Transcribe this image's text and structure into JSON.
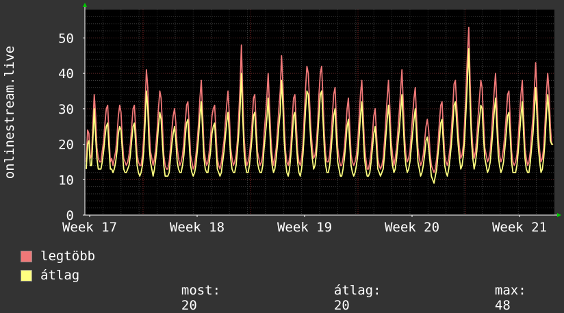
{
  "colors": {
    "background": "#333333",
    "plot_background": "#000000",
    "grid_minor": "#3a3a3a",
    "grid_major_vertical": "#7a1f1f",
    "max_series": "#f07878",
    "avg_series": "#ffff80",
    "axis_arrow": "#00cc00"
  },
  "chart_data": {
    "type": "line",
    "ylabel": "onlinestream.live",
    "ylim": [
      0,
      58
    ],
    "yticks": [
      0,
      10,
      20,
      30,
      40,
      50
    ],
    "xticks": [
      "Week 17",
      "Week 18",
      "Week 19",
      "Week 20",
      "Week 21"
    ],
    "grid": true,
    "series": [
      {
        "name": "legtöbb",
        "color": "#f07878",
        "values": [
          15,
          24,
          23,
          16,
          17,
          26,
          34,
          28,
          19,
          16,
          15,
          15,
          18,
          21,
          26,
          30,
          31,
          23,
          15,
          16,
          14,
          16,
          18,
          22,
          28,
          31,
          29,
          21,
          16,
          15,
          14,
          15,
          17,
          20,
          25,
          30,
          31,
          24,
          17,
          15,
          14,
          14,
          17,
          22,
          31,
          41,
          36,
          25,
          18,
          16,
          14,
          16,
          19,
          24,
          30,
          35,
          33,
          25,
          17,
          14,
          13,
          13,
          15,
          19,
          24,
          28,
          30,
          26,
          19,
          16,
          14,
          15,
          17,
          21,
          26,
          31,
          32,
          25,
          17,
          15,
          13,
          14,
          17,
          21,
          26,
          33,
          38,
          29,
          19,
          16,
          14,
          15,
          18,
          22,
          28,
          30,
          31,
          23,
          16,
          14,
          13,
          15,
          18,
          21,
          26,
          31,
          35,
          28,
          19,
          16,
          14,
          15,
          17,
          21,
          28,
          36,
          48,
          34,
          22,
          17,
          14,
          15,
          17,
          21,
          26,
          33,
          34,
          26,
          18,
          16,
          14,
          15,
          17,
          23,
          28,
          33,
          40,
          31,
          22,
          17,
          14,
          16,
          19,
          24,
          30,
          35,
          45,
          37,
          26,
          18,
          15,
          14,
          16,
          20,
          27,
          33,
          34,
          26,
          18,
          15,
          14,
          16,
          20,
          28,
          36,
          42,
          40,
          32,
          24,
          19,
          16,
          17,
          20,
          26,
          34,
          40,
          42,
          33,
          23,
          17,
          15,
          15,
          17,
          22,
          28,
          34,
          36,
          27,
          19,
          16,
          14,
          14,
          16,
          19,
          24,
          30,
          33,
          25,
          17,
          15,
          14,
          15,
          17,
          21,
          27,
          34,
          38,
          29,
          20,
          16,
          13,
          13,
          15,
          18,
          23,
          28,
          30,
          23,
          16,
          14,
          13,
          14,
          16,
          21,
          27,
          33,
          38,
          30,
          21,
          17,
          14,
          16,
          19,
          24,
          29,
          35,
          41,
          32,
          22,
          17,
          15,
          16,
          18,
          23,
          28,
          33,
          36,
          27,
          19,
          16,
          14,
          15,
          17,
          21,
          25,
          27,
          24,
          18,
          14,
          13,
          12,
          13,
          16,
          20,
          26,
          31,
          32,
          24,
          17,
          15,
          14,
          16,
          19,
          24,
          30,
          37,
          38,
          31,
          24,
          19,
          16,
          17,
          20,
          27,
          36,
          45,
          53,
          38,
          25,
          19,
          16,
          18,
          22,
          28,
          33,
          38,
          36,
          27,
          19,
          17,
          15,
          16,
          18,
          23,
          29,
          35,
          40,
          31,
          21,
          17,
          15,
          16,
          19,
          23,
          28,
          34,
          35,
          27,
          18,
          15,
          14,
          15,
          17,
          22,
          28,
          34,
          38,
          28,
          19,
          16,
          14,
          15,
          18,
          23,
          28,
          35,
          43,
          34,
          23,
          18,
          15,
          16,
          19,
          26,
          34,
          40,
          35,
          25,
          20,
          20
        ]
      },
      {
        "name": "átlag",
        "color": "#ffff80",
        "values": [
          13,
          20,
          21,
          14,
          14,
          22,
          30,
          22,
          16,
          13,
          13,
          13,
          15,
          18,
          22,
          25,
          26,
          19,
          13,
          13,
          12,
          13,
          15,
          18,
          23,
          25,
          24,
          18,
          13,
          12,
          12,
          13,
          14,
          17,
          21,
          25,
          26,
          20,
          14,
          12,
          11,
          12,
          14,
          18,
          26,
          35,
          30,
          20,
          15,
          13,
          11,
          13,
          16,
          20,
          25,
          29,
          27,
          20,
          14,
          11,
          11,
          11,
          12,
          16,
          20,
          23,
          25,
          21,
          15,
          13,
          12,
          12,
          14,
          17,
          22,
          26,
          27,
          20,
          14,
          12,
          11,
          12,
          14,
          18,
          22,
          28,
          32,
          24,
          16,
          13,
          12,
          12,
          15,
          18,
          23,
          25,
          26,
          19,
          13,
          12,
          11,
          12,
          15,
          18,
          22,
          26,
          29,
          23,
          16,
          13,
          12,
          12,
          14,
          18,
          23,
          30,
          40,
          28,
          18,
          14,
          12,
          12,
          14,
          18,
          22,
          28,
          29,
          22,
          15,
          13,
          12,
          12,
          14,
          19,
          23,
          27,
          33,
          26,
          18,
          14,
          12,
          13,
          16,
          20,
          25,
          29,
          38,
          31,
          21,
          15,
          12,
          11,
          13,
          17,
          22,
          28,
          29,
          21,
          15,
          12,
          11,
          13,
          17,
          23,
          30,
          35,
          34,
          27,
          20,
          16,
          13,
          14,
          17,
          22,
          28,
          34,
          35,
          27,
          19,
          14,
          12,
          12,
          14,
          18,
          23,
          28,
          30,
          22,
          15,
          13,
          11,
          11,
          13,
          16,
          20,
          25,
          27,
          20,
          14,
          12,
          11,
          12,
          14,
          17,
          22,
          28,
          32,
          24,
          16,
          13,
          11,
          11,
          12,
          15,
          19,
          23,
          25,
          19,
          13,
          12,
          11,
          12,
          13,
          17,
          22,
          27,
          31,
          25,
          17,
          14,
          12,
          13,
          16,
          20,
          24,
          29,
          34,
          26,
          18,
          14,
          12,
          13,
          15,
          19,
          23,
          27,
          30,
          22,
          15,
          13,
          11,
          12,
          14,
          17,
          21,
          22,
          19,
          15,
          11,
          10,
          9,
          11,
          13,
          17,
          21,
          26,
          27,
          20,
          14,
          12,
          11,
          13,
          16,
          20,
          25,
          31,
          32,
          26,
          20,
          16,
          13,
          14,
          17,
          22,
          30,
          38,
          47,
          32,
          21,
          16,
          13,
          15,
          18,
          23,
          27,
          31,
          30,
          22,
          16,
          14,
          12,
          13,
          15,
          19,
          24,
          29,
          33,
          25,
          17,
          14,
          12,
          13,
          15,
          19,
          23,
          28,
          29,
          22,
          15,
          12,
          12,
          12,
          14,
          18,
          23,
          28,
          32,
          23,
          16,
          13,
          12,
          12,
          15,
          19,
          23,
          29,
          36,
          28,
          19,
          15,
          12,
          13,
          16,
          21,
          28,
          34,
          29,
          21,
          20,
          20
        ]
      }
    ]
  },
  "legend": {
    "max_label": "legtöbb",
    "avg_label": "átlag"
  },
  "stats": {
    "now_label": "most:",
    "now_value": "20",
    "avg_label": "átlag:",
    "avg_value": "20",
    "max_label": "max:",
    "max_value": "48"
  }
}
